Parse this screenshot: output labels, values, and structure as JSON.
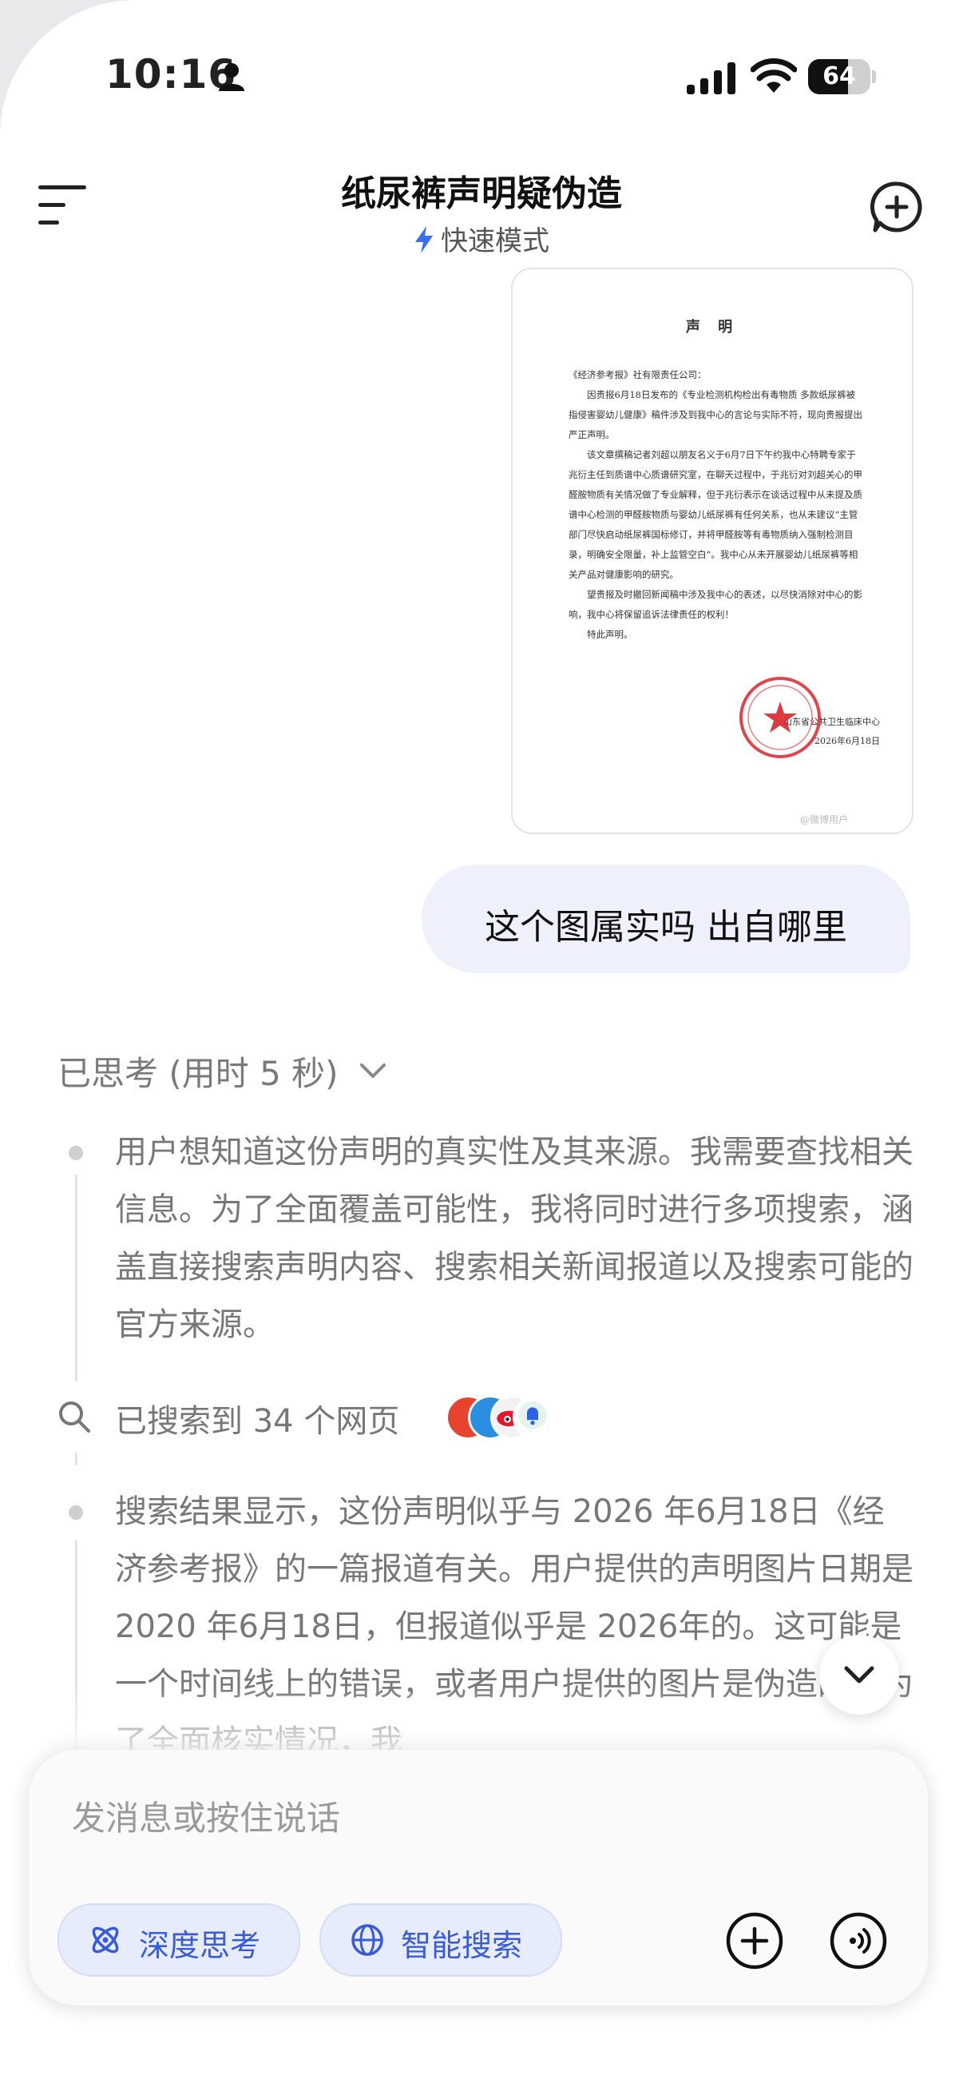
{
  "status_bar": {
    "time": "10:16",
    "battery_percent": "64",
    "battery_level": 0.64
  },
  "header": {
    "title": "纸尿裤声明疑伪造",
    "mode": "快速模式"
  },
  "document_image": {
    "title": "声 明",
    "addressee": "《经济参考报》社有限责任公司：",
    "paragraphs": [
      "因贵报6月18日发布的《专业检测机构检出有毒物质 多款纸尿裤被指侵害婴幼儿健康》稿件涉及到我中心的言论与实际不符，现向贵报提出严正声明。",
      "该文章撰稿记者刘超以朋友名义于6月7日下午约我中心特聘专家于兆衍主任到质谱中心质谱研究室，在聊天过程中，于兆衍对刘超关心的甲醛胺物质有关情况做了专业解释，但于兆衍表示在谈话过程中从未提及质谱中心检测的甲醛胺物质与婴幼儿纸尿裤有任何关系，也从未建议“主管部门尽快启动纸尿裤国标修订，并将甲醛胺等有毒物质纳入强制检测目录，明确安全限量，补上监管空白”。我中心从未开展婴幼儿纸尿裤等相关产品对健康影响的研究。",
      "望贵报及时撤回新闻稿中涉及我中心的表述，以尽快消除对中心的影响，我中心将保留追诉法律责任的权利！",
      "特此声明。"
    ],
    "signature": "山东省公共卫生临床中心",
    "date": "2026年6月18日",
    "watermark": "@微博用户"
  },
  "chat": {
    "user_message": "这个图属实吗 出自哪里",
    "thinking_label": "已思考 (用时 5 秒)",
    "thoughts": [
      "用户想知道这份声明的真实性及其来源。我需要查找相关信息。为了全面覆盖可能性，我将同时进行多项搜索，涵盖直接搜索声明内容、搜索相关新闻报道以及搜索可能的官方来源。",
      "搜索结果显示，这份声明似乎与 2026 年6月18日《经济参考报》的一篇报道有关。用户提供的声明图片日期是2020 年6月18日，但报道似乎是 2026年的。这可能是一个时间线上的错误，或者用户提供的图片是伪造的。为了全面核实情况，我"
    ],
    "search_result": "已搜索到 34 个网页"
  },
  "composer": {
    "placeholder": "发消息或按住说话",
    "deep_think_label": "深度思考",
    "smart_search_label": "智能搜索"
  },
  "colors": {
    "accent": "#3a5bd9",
    "pill_bg": "#e7ecfb",
    "user_bubble": "#eef1fb",
    "seal": "#d8262c"
  }
}
